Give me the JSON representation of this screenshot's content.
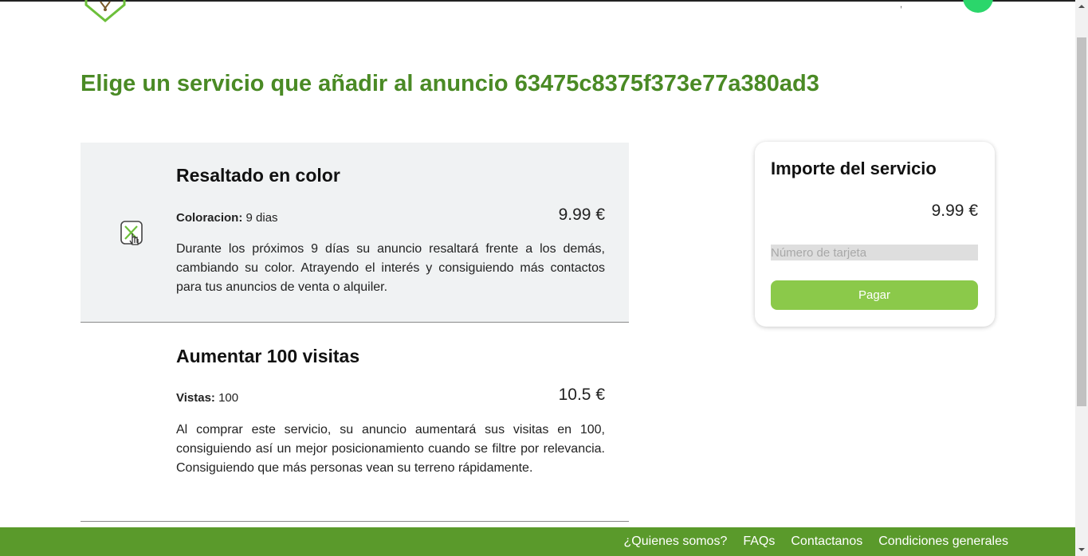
{
  "page": {
    "title": "Elige un servicio que añadir al anuncio 63475c8375f373e77a380ad3"
  },
  "services": [
    {
      "title": "Resaltado en color",
      "meta_label": "Coloracion:",
      "meta_value": "9 dias",
      "price": "9.99 €",
      "description": "Durante los próximos 9 días su anuncio resaltará frente a los demás, cambiando su color. Atrayendo el interés y consiguiendo más contactos para tus anuncios de venta o alquiler.",
      "icon": "color-highlight-icon",
      "selected": true
    },
    {
      "title": "Aumentar 100 visitas",
      "meta_label": "Vistas:",
      "meta_value": "100",
      "price": "10.5 €",
      "description": "Al comprar este servicio, su anuncio aumentará sus visitas en 100, consiguiendo así un mejor posicionamiento cuando se filtre por relevancia. Consiguiendo que más personas vean su terreno rápidamente.",
      "selected": false
    }
  ],
  "summary": {
    "title": "Importe del servicio",
    "price": "9.99 €",
    "card_placeholder": "Número de tarjeta",
    "card_value": "",
    "pay_label": "Pagar"
  },
  "footer": {
    "links": [
      {
        "label": "¿Quienes somos?"
      },
      {
        "label": "FAQs"
      },
      {
        "label": "Contactanos"
      },
      {
        "label": "Condiciones generales"
      }
    ]
  },
  "colors": {
    "title_green": "#4a8a25",
    "footer_green": "#5a9a2b",
    "pay_button": "#8bc94a",
    "selected_bg": "#f0f2f3",
    "avatar": "#2bd66b"
  }
}
